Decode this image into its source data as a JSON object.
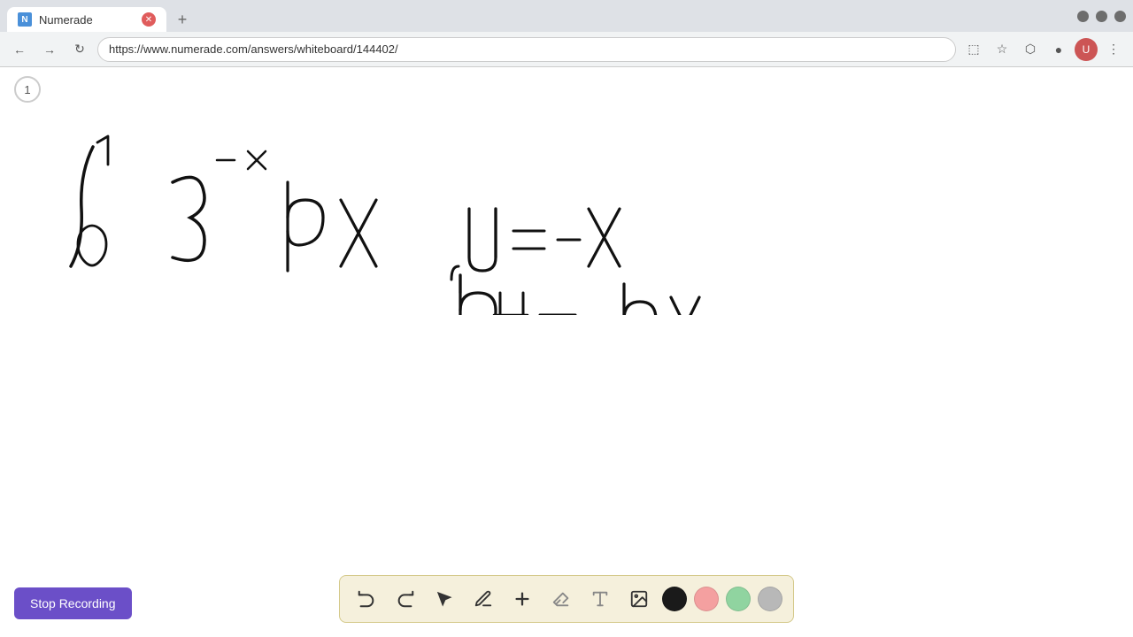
{
  "browser": {
    "tab_title": "Numerade",
    "tab_favicon_text": "N",
    "url": "https://www.numerade.com/answers/whiteboard/144402/",
    "new_tab_symbol": "+",
    "back_symbol": "←",
    "forward_symbol": "→",
    "refresh_symbol": "↻"
  },
  "page_indicator": "1",
  "stop_recording_label": "Stop Recording",
  "toolbar": {
    "undo_label": "↺",
    "redo_label": "↻",
    "select_label": "▲",
    "pen_label": "✏",
    "add_label": "+",
    "eraser_label": "▫",
    "text_label": "A",
    "image_label": "🖼"
  },
  "colors": {
    "black": "#1a1a1a",
    "pink": "#f4a0a0",
    "green": "#90d4a0",
    "gray": "#b0b0b0",
    "accent_purple": "#6b4fc8"
  }
}
